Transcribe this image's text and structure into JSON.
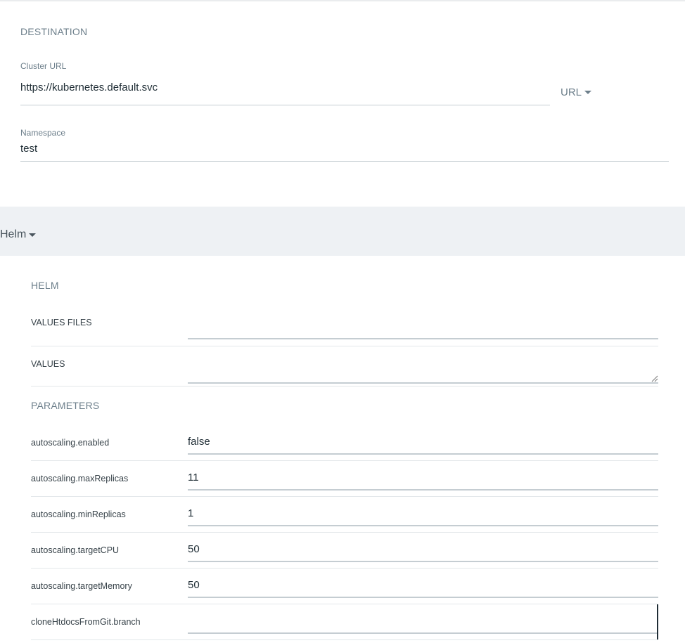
{
  "destination": {
    "title": "DESTINATION",
    "cluster_url_label": "Cluster URL",
    "cluster_url_value": "https://kubernetes.default.svc",
    "url_mode": "URL",
    "namespace_label": "Namespace",
    "namespace_value": "test"
  },
  "source_type": "Helm",
  "helm": {
    "title": "HELM",
    "values_files_label": "VALUES FILES",
    "values_label": "VALUES",
    "parameters_title": "PARAMETERS",
    "parameters": [
      {
        "name": "autoscaling.enabled",
        "value": "false"
      },
      {
        "name": "autoscaling.maxReplicas",
        "value": "11"
      },
      {
        "name": "autoscaling.minReplicas",
        "value": "1"
      },
      {
        "name": "autoscaling.targetCPU",
        "value": "50"
      },
      {
        "name": "autoscaling.targetMemory",
        "value": "50"
      },
      {
        "name": "cloneHtdocsFromGit.branch",
        "value": ""
      }
    ]
  }
}
